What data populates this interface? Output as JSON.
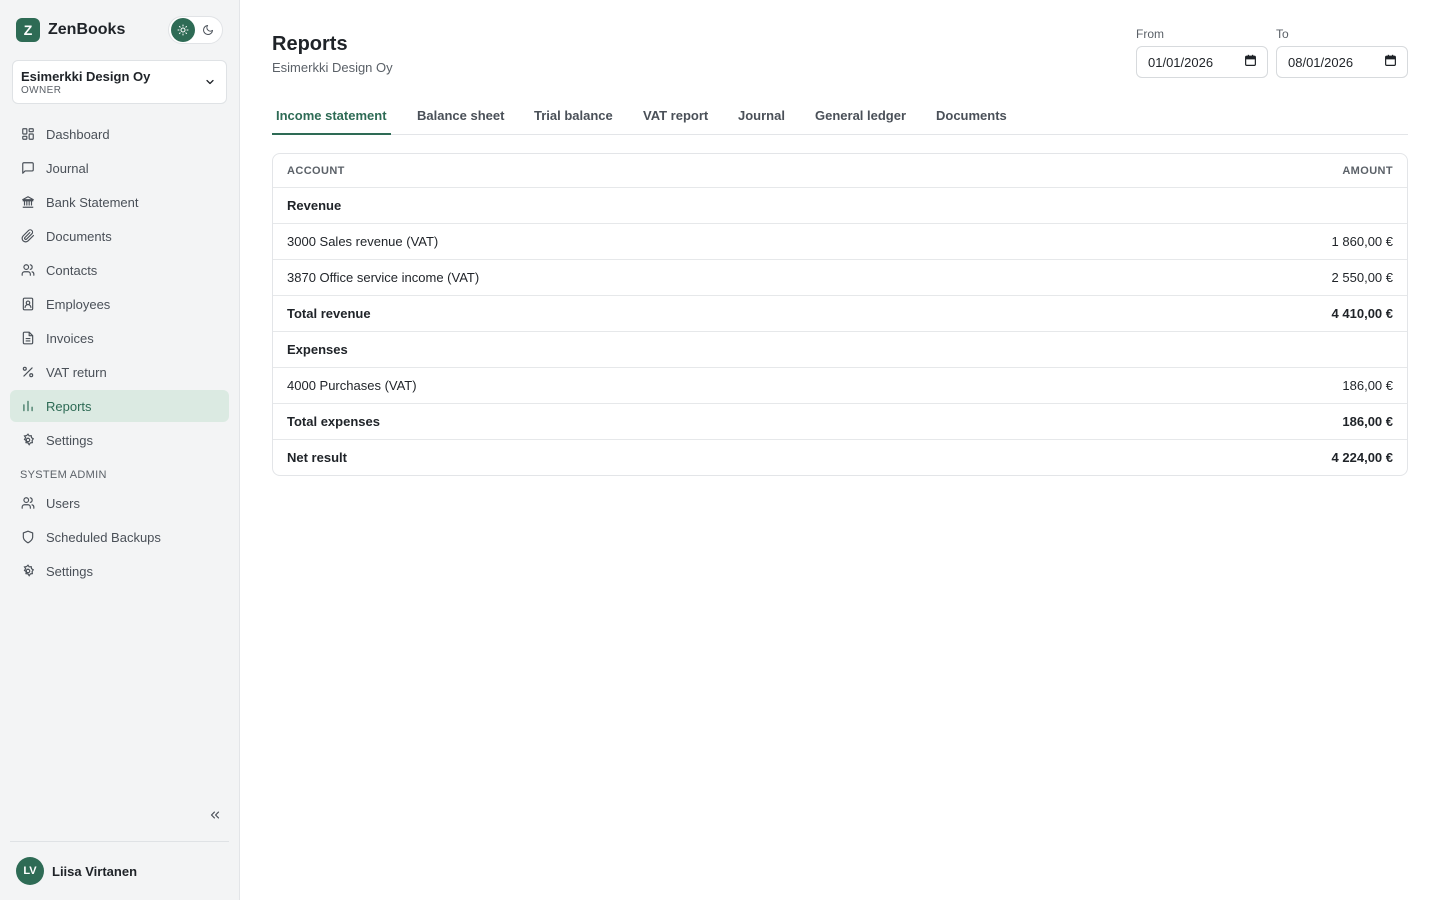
{
  "app": {
    "name": "ZenBooks",
    "logo_letter": "Z",
    "accent_color": "#2e6b55"
  },
  "theme_toggle": {
    "light_icon": "sun-icon",
    "dark_icon": "moon-icon",
    "active": "light"
  },
  "org": {
    "name": "Esimerkki Design Oy",
    "role": "OWNER"
  },
  "sidebar": {
    "items": [
      {
        "label": "Dashboard",
        "icon": "grid-icon"
      },
      {
        "label": "Journal",
        "icon": "message-square-icon"
      },
      {
        "label": "Bank Statement",
        "icon": "bank-icon"
      },
      {
        "label": "Documents",
        "icon": "paperclip-icon"
      },
      {
        "label": "Contacts",
        "icon": "users-icon"
      },
      {
        "label": "Employees",
        "icon": "id-badge-icon"
      },
      {
        "label": "Invoices",
        "icon": "file-text-icon"
      },
      {
        "label": "VAT return",
        "icon": "percent-icon"
      },
      {
        "label": "Reports",
        "icon": "bar-chart-icon",
        "active": true
      },
      {
        "label": "Settings",
        "icon": "gear-icon"
      }
    ],
    "admin_section_label": "SYSTEM ADMIN",
    "admin_items": [
      {
        "label": "Users",
        "icon": "users-icon"
      },
      {
        "label": "Scheduled Backups",
        "icon": "shield-icon"
      },
      {
        "label": "Settings",
        "icon": "gear-icon"
      }
    ]
  },
  "user": {
    "initials": "LV",
    "name": "Liisa Virtanen"
  },
  "page": {
    "title": "Reports",
    "subtitle": "Esimerkki Design Oy"
  },
  "date_range": {
    "from_label": "From",
    "from_value": "01/01/2026",
    "to_label": "To",
    "to_value": "08/01/2026"
  },
  "tabs": [
    {
      "label": "Income statement",
      "active": true
    },
    {
      "label": "Balance sheet"
    },
    {
      "label": "Trial balance"
    },
    {
      "label": "VAT report"
    },
    {
      "label": "Journal"
    },
    {
      "label": "General ledger"
    },
    {
      "label": "Documents"
    }
  ],
  "table": {
    "headers": {
      "account": "ACCOUNT",
      "amount": "AMOUNT"
    },
    "rows": [
      {
        "account": "Revenue",
        "amount": "",
        "bold": true
      },
      {
        "account": "3000 Sales revenue (VAT)",
        "amount": "1 860,00 €"
      },
      {
        "account": "3870 Office service income (VAT)",
        "amount": "2 550,00 €"
      },
      {
        "account": "Total revenue",
        "amount": "4 410,00 €",
        "bold": true
      },
      {
        "account": "Expenses",
        "amount": "",
        "bold": true
      },
      {
        "account": "4000 Purchases (VAT)",
        "amount": "186,00 €"
      },
      {
        "account": "Total expenses",
        "amount": "186,00 €",
        "bold": true
      },
      {
        "account": "Net result",
        "amount": "4 224,00 €",
        "bold": true
      }
    ]
  }
}
